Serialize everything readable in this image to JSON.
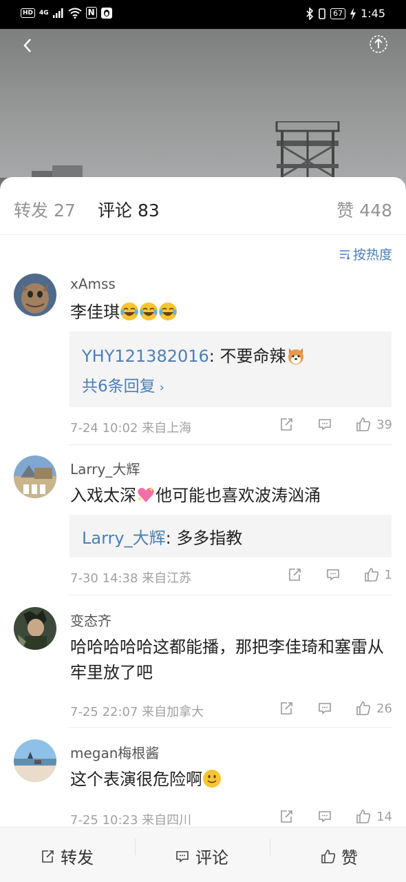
{
  "status_bar": {
    "hd_label": "HD",
    "net_label": "4G",
    "nfc_label": "N",
    "battery": "67",
    "time": "1:45"
  },
  "tabs": {
    "repost_label": "转发",
    "repost_count": "27",
    "comment_label": "评论",
    "comment_count": "83",
    "like_label": "赞",
    "like_count": "448"
  },
  "sort_label": "按热度",
  "comments": [
    {
      "username": "xAmss",
      "text": "李佳琪",
      "reply": {
        "user": "YHY121382016",
        "text": "不要命辣"
      },
      "reply_more": "共6条回复",
      "time": "7-24 10:02 来自上海",
      "likes": "39"
    },
    {
      "username": "Larry_大辉",
      "text_before": "入戏太深",
      "text_after": "他可能也喜欢波涛汹涌",
      "reply": {
        "user": "Larry_大辉",
        "text": "多多指教"
      },
      "time": "7-30 14:38 来自江苏",
      "likes": "1"
    },
    {
      "username": "变态齐",
      "text": "哈哈哈哈哈这都能播，那把李佳琦和塞雷从牢里放了吧",
      "time": "7-25 22:07 来自加拿大",
      "likes": "26"
    },
    {
      "username": "megan梅根酱",
      "text": "这个表演很危险啊",
      "time": "7-25 10:23 来自四川",
      "likes": "14"
    }
  ],
  "bottom_bar": {
    "repost": "转发",
    "comment": "评论",
    "like": "赞"
  },
  "colors": {
    "link_blue": "#4a7fb7",
    "muted": "#a0a0a0",
    "reply_bg": "#f4f4f4"
  }
}
